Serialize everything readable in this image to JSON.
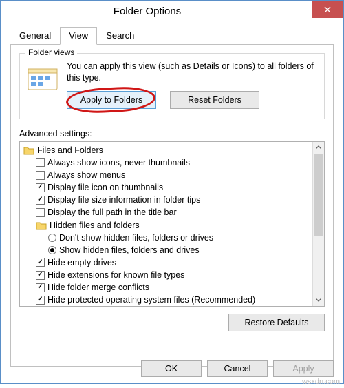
{
  "window": {
    "title": "Folder Options"
  },
  "tabs": {
    "general": "General",
    "view": "View",
    "search": "Search"
  },
  "folder_views": {
    "label": "Folder views",
    "desc": "You can apply this view (such as Details or Icons) to all folders of this type.",
    "apply": "Apply to Folders",
    "reset": "Reset Folders"
  },
  "advanced": {
    "label": "Advanced settings:",
    "root": "Files and Folders",
    "items": [
      {
        "type": "cb",
        "checked": false,
        "label": "Always show icons, never thumbnails"
      },
      {
        "type": "cb",
        "checked": false,
        "label": "Always show menus"
      },
      {
        "type": "cb",
        "checked": true,
        "label": "Display file icon on thumbnails"
      },
      {
        "type": "cb",
        "checked": true,
        "label": "Display file size information in folder tips"
      },
      {
        "type": "cb",
        "checked": false,
        "label": "Display the full path in the title bar"
      },
      {
        "type": "folder",
        "label": "Hidden files and folders"
      },
      {
        "type": "rb",
        "selected": false,
        "label": "Don't show hidden files, folders or drives"
      },
      {
        "type": "rb",
        "selected": true,
        "label": "Show hidden files, folders and drives"
      },
      {
        "type": "cb",
        "checked": true,
        "label": "Hide empty drives"
      },
      {
        "type": "cb",
        "checked": true,
        "label": "Hide extensions for known file types"
      },
      {
        "type": "cb",
        "checked": true,
        "label": "Hide folder merge conflicts"
      },
      {
        "type": "cb",
        "checked": true,
        "label": "Hide protected operating system files (Recommended)"
      }
    ],
    "restore": "Restore Defaults"
  },
  "footer": {
    "ok": "OK",
    "cancel": "Cancel",
    "apply": "Apply"
  },
  "watermark": "wsxdn.com"
}
